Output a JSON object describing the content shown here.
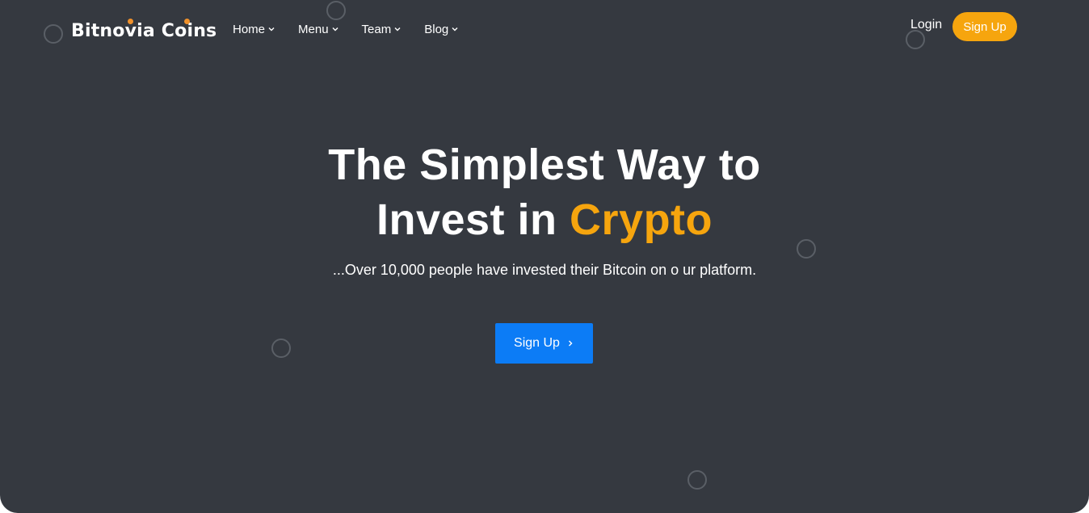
{
  "brand": {
    "name": "Bitnovia Coins",
    "accent_color": "#f6a50e",
    "dot_color": "#f0912b"
  },
  "nav": {
    "items": [
      {
        "label": "Home",
        "icon": "chevron-down-icon"
      },
      {
        "label": "Menu",
        "icon": "chevron-down-icon"
      },
      {
        "label": "Team",
        "icon": "chevron-down-icon"
      },
      {
        "label": "Blog",
        "icon": "chevron-down-icon"
      }
    ],
    "login_label": "Login",
    "signup_label": "Sign Up"
  },
  "hero": {
    "headline_line1": "The Simplest Way to",
    "headline_line2_prefix": "Invest in ",
    "headline_accent": "Crypto",
    "subline": "...Over 10,000 people have invested their Bitcoin on o ur platform.",
    "cta_label": "Sign Up",
    "cta_icon": "chevron-right-icon",
    "background_color": "#353940",
    "cta_color": "#0c7cf6"
  }
}
